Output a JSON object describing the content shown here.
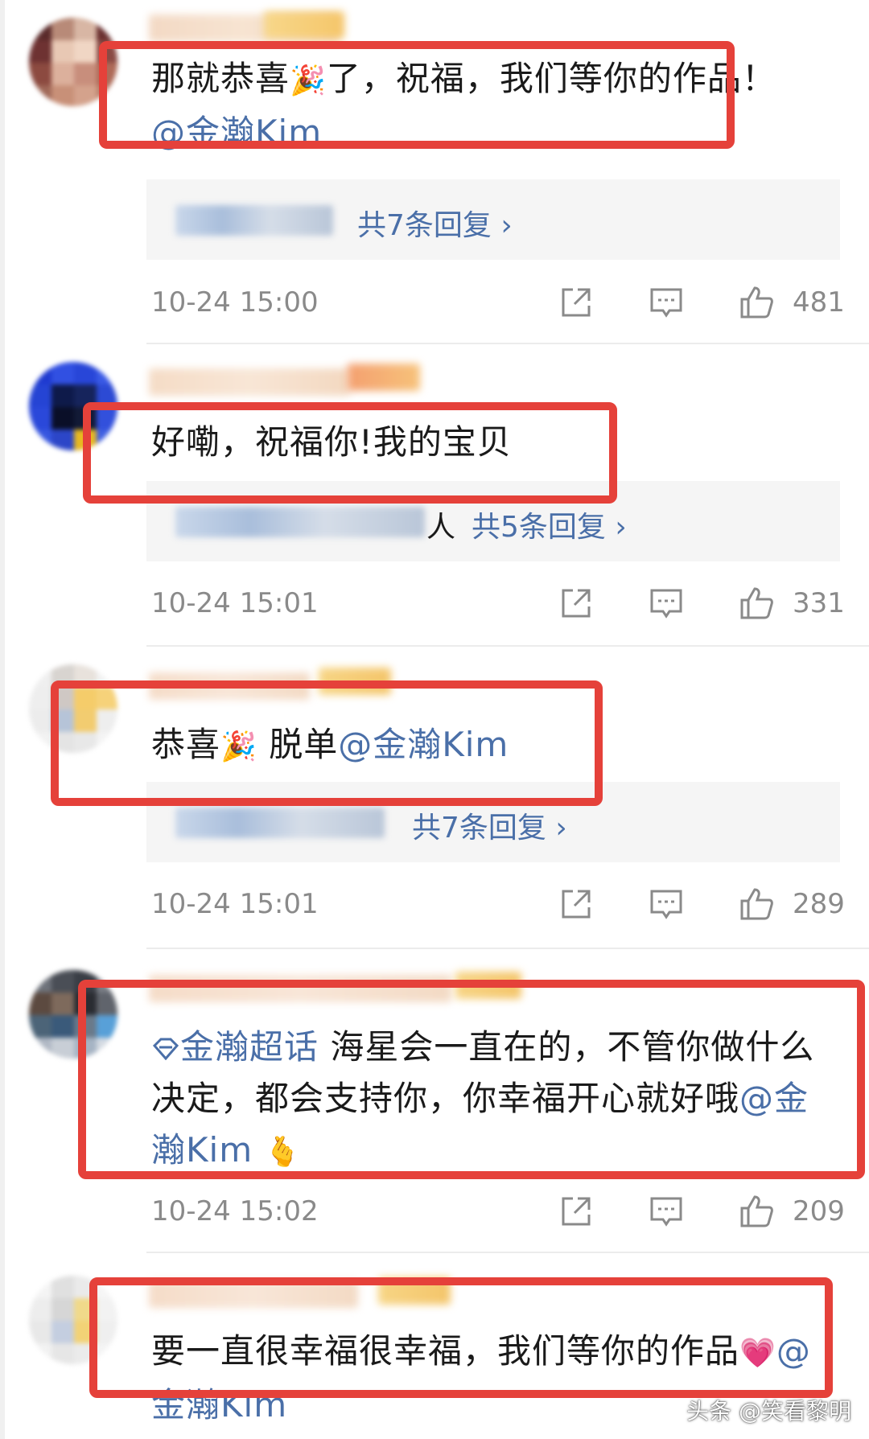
{
  "comments": [
    {
      "text_before": "那就恭喜",
      "emoji": "🎉",
      "text_after": "了，祝福，我们等你的作品！",
      "mention": "@金瀚Kim",
      "reply_count": "共7条回复 ›",
      "timestamp": "10-24 15:00",
      "likes": "481"
    },
    {
      "text_before": "好嘞，祝福你!我的宝贝",
      "reply_suffix": "人",
      "reply_count": "共5条回复 ›",
      "timestamp": "10-24 15:01",
      "likes": "331"
    },
    {
      "text_before": "恭喜",
      "emoji": "🎉",
      "text_after": " 脱单",
      "mention": "@金瀚Kim",
      "reply_count": "共7条回复 ›",
      "timestamp": "10-24 15:01",
      "likes": "289"
    },
    {
      "topic": "金瀚超话",
      "text_before": " 海星会一直在的，不管你做什么决定，都会支持你，你幸福开心就好哦",
      "mention_inline": "@",
      "mention": "金瀚Kim",
      "emoji": "🫰",
      "timestamp": "10-24 15:02",
      "likes": "209"
    },
    {
      "text_before": "要一直很幸福很幸福，我们等你的作品",
      "emoji": "💗",
      "mention_inline": "@",
      "mention_next": "金瀚Kim"
    }
  ],
  "watermark": "头条 @笑看黎明",
  "colors": {
    "highlight": "#e5413a",
    "link": "#4a6fa8",
    "meta": "#8a8a8a",
    "reply_bg": "#f5f5f5"
  },
  "icons": [
    "share-icon",
    "comment-icon",
    "like-icon",
    "topic-diamond-icon"
  ]
}
